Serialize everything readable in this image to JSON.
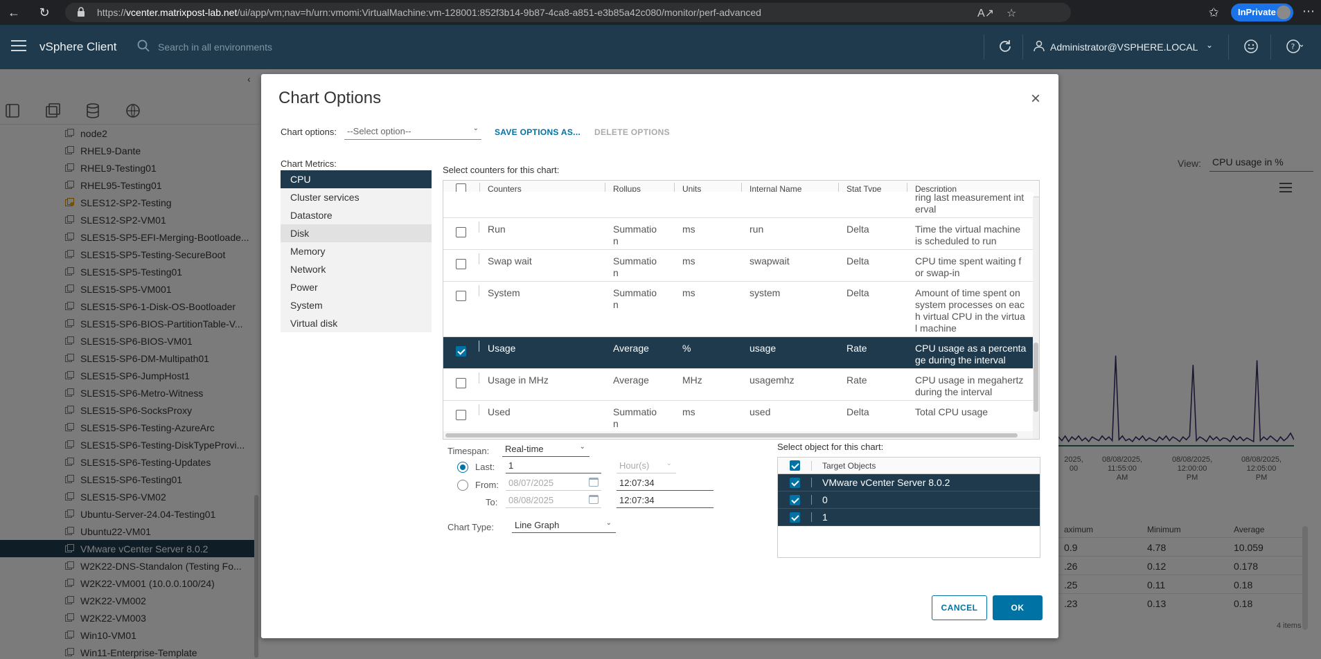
{
  "browser": {
    "url_prefix": "https://",
    "url_host": "vcenter.matrixpost-lab.net",
    "url_path": "/ui/app/vm;nav=h/urn:vmomi:VirtualMachine:vm-128001:852f3b14-9b87-4ca8-a851-e3b85a42c080/monitor/perf-advanced",
    "inprivate_label": "InPrivate"
  },
  "header": {
    "app_name": "vSphere Client",
    "search_placeholder": "Search in all environments",
    "user": "Administrator@VSPHERE.LOCAL"
  },
  "inventory": {
    "items": [
      "node2",
      "RHEL9-Dante",
      "RHEL9-Testing01",
      "RHEL95-Testing01",
      "SLES12-SP2-Testing",
      "SLES12-SP2-VM01",
      "SLES15-SP5-EFI-Merging-Bootloade...",
      "SLES15-SP5-Testing-SecureBoot",
      "SLES15-SP5-Testing01",
      "SLES15-SP5-VM001",
      "SLES15-SP6-1-Disk-OS-Bootloader",
      "SLES15-SP6-BIOS-PartitionTable-V...",
      "SLES15-SP6-BIOS-VM01",
      "SLES15-SP6-DM-Multipath01",
      "SLES15-SP6-JumpHost1",
      "SLES15-SP6-Metro-Witness",
      "SLES15-SP6-SocksProxy",
      "SLES15-SP6-Testing-AzureArc",
      "SLES15-SP6-Testing-DiskTypeProvi...",
      "SLES15-SP6-Testing-Updates",
      "SLES15-SP6-Testing01",
      "SLES15-SP6-VM02",
      "Ubuntu-Server-24.04-Testing01",
      "Ubuntu22-VM01",
      "VMware vCenter Server 8.0.2",
      "W2K22-DNS-Standalon (Testing Fo...",
      "W2K22-VM001 (10.0.0.100/24)",
      "W2K22-VM002",
      "W2K22-VM003",
      "Win10-VM01",
      "Win11-Enterprise-Template"
    ],
    "selected_index": 24,
    "warning_index": 4
  },
  "background": {
    "view_label": "View:",
    "view_value": "CPU usage in %",
    "x_ticks": [
      [
        "2025,",
        "00",
        ""
      ],
      [
        "08/08/2025,",
        "11:55:00",
        "AM"
      ],
      [
        "08/08/2025,",
        "12:00:00",
        "PM"
      ],
      [
        "08/08/2025,",
        "12:05:00",
        "PM"
      ]
    ],
    "table_headers": [
      "aximum",
      "Minimum",
      "Average"
    ],
    "table_rows": [
      [
        "0.9",
        "4.78",
        "10.059"
      ],
      [
        ".26",
        "0.12",
        "0.178"
      ],
      [
        ".25",
        "0.11",
        "0.18"
      ],
      [
        ".23",
        "0.13",
        "0.18"
      ]
    ],
    "items_count": "4 items"
  },
  "modal": {
    "title": "Chart Options",
    "chart_options_label": "Chart options:",
    "chart_options_placeholder": "--Select option--",
    "save_options": "SAVE OPTIONS AS...",
    "delete_options": "DELETE OPTIONS",
    "metrics_label": "Chart Metrics:",
    "metrics": [
      "CPU",
      "Cluster services",
      "Datastore",
      "Disk",
      "Memory",
      "Network",
      "Power",
      "System",
      "Virtual disk"
    ],
    "metrics_selected": "CPU",
    "metrics_hover": "Disk",
    "counters_label": "Select counters for this chart:",
    "counters_columns": [
      "Counters",
      "Rollups",
      "Units",
      "Internal Name",
      "Stat Type",
      "Description"
    ],
    "partial_top_description": [
      "ring last measurement int",
      "erval"
    ],
    "counters": [
      {
        "name": "Run",
        "rollup": [
          "Summatio",
          "n"
        ],
        "units": "ms",
        "internal": "run",
        "stat": "Delta",
        "desc": [
          "Time the virtual machine",
          "is scheduled to run"
        ],
        "checked": false
      },
      {
        "name": "Swap wait",
        "rollup": [
          "Summatio",
          "n"
        ],
        "units": "ms",
        "internal": "swapwait",
        "stat": "Delta",
        "desc": [
          "CPU time spent waiting f",
          "or swap-in"
        ],
        "checked": false
      },
      {
        "name": "System",
        "rollup": [
          "Summatio",
          "n"
        ],
        "units": "ms",
        "internal": "system",
        "stat": "Delta",
        "desc": [
          "Amount of time spent on",
          "system processes on eac",
          "h virtual CPU in the virtua",
          "l machine"
        ],
        "checked": false
      },
      {
        "name": "Usage",
        "rollup": [
          "Average"
        ],
        "units": "%",
        "internal": "usage",
        "stat": "Rate",
        "desc": [
          "CPU usage as a percenta",
          "ge during the interval"
        ],
        "checked": true
      },
      {
        "name": "Usage in MHz",
        "rollup": [
          "Average"
        ],
        "units": "MHz",
        "internal": "usagemhz",
        "stat": "Rate",
        "desc": [
          "CPU usage in megahertz",
          "during the interval"
        ],
        "checked": false
      },
      {
        "name": "Used",
        "rollup": [
          "Summatio",
          "n"
        ],
        "units": "ms",
        "internal": "used",
        "stat": "Delta",
        "desc": [
          "Total CPU usage"
        ],
        "checked": false
      }
    ],
    "timespan_label": "Timespan:",
    "timespan_value": "Real-time",
    "last_label": "Last:",
    "last_value": "1",
    "last_unit": "Hour(s)",
    "from_label": "From:",
    "from_date": "08/07/2025",
    "from_time": "12:07:34",
    "to_label": "To:",
    "to_date": "08/08/2025",
    "to_time": "12:07:34",
    "chart_type_label": "Chart Type:",
    "chart_type_value": "Line Graph",
    "objects_label": "Select object for this chart:",
    "objects_header": "Target Objects",
    "objects": [
      "VMware vCenter Server 8.0.2",
      "0",
      "1"
    ],
    "cancel": "CANCEL",
    "ok": "OK"
  },
  "colors": {
    "header_bg": "#1e3a4c",
    "accent": "#0072a3",
    "chart_line": "#3d2b6b"
  }
}
